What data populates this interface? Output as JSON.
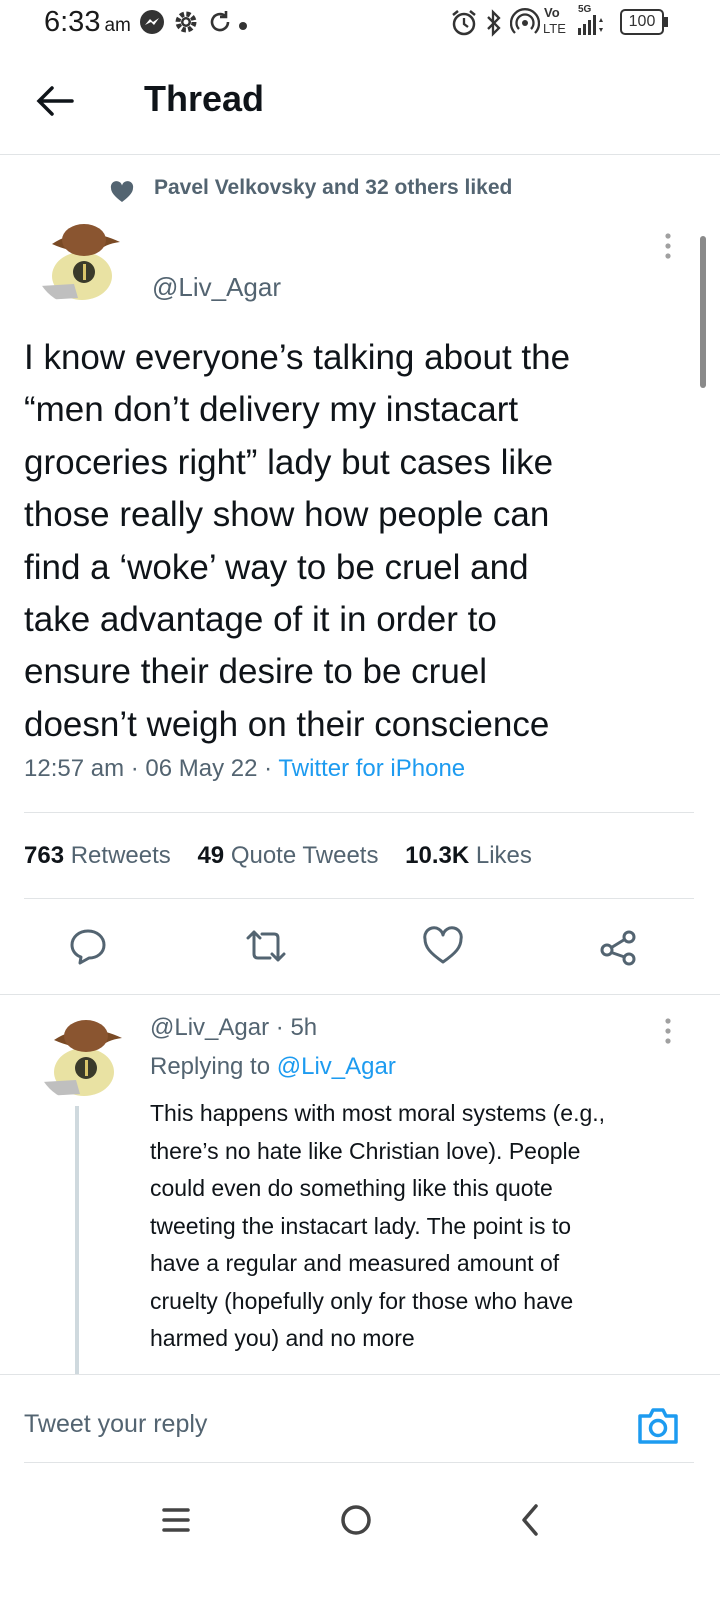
{
  "status_bar": {
    "time": "6:33",
    "ampm": "am",
    "network_vo": "Vo",
    "network_lte": "LTE",
    "network_5g": "5G",
    "battery": "100"
  },
  "header": {
    "title": "Thread"
  },
  "social_context": {
    "text": "Pavel Velkovsky and 32 others liked"
  },
  "main_tweet": {
    "handle": "@Liv_Agar",
    "text": "I know everyone’s talking about the\n“men don’t delivery my instacart\ngroceries right” lady but cases like\nthose really show how people can\nfind a ‘woke’ way to be cruel and\ntake advantage of it in order to\nensure their desire to be cruel\ndoesn’t weigh on their conscience",
    "time": "12:57 am",
    "date": "06 May 22",
    "source": "Twitter for iPhone",
    "separator": "·",
    "stats": {
      "retweets_count": "763",
      "retweets_label": "Retweets",
      "quotes_count": "49",
      "quotes_label": "Quote Tweets",
      "likes_count": "10.3K",
      "likes_label": "Likes"
    }
  },
  "reply_tweet": {
    "handle": "@Liv_Agar",
    "age": "5h",
    "separator": "·",
    "replying_to_label": "Replying to",
    "replying_to_handle": "@Liv_Agar",
    "text": "This happens with most moral systems (e.g.,\nthere’s no hate like Christian love). People\ncould even do something like this quote\ntweeting the instacart lady. The point is to\nhave a regular and measured amount of\ncruelty (hopefully only for those who have\nharmed you) and no more"
  },
  "reply_bar": {
    "placeholder": "Tweet your reply"
  },
  "colors": {
    "accent": "#1d9bf0",
    "text_primary": "#0f1419",
    "text_secondary": "#536471",
    "divider": "#e1e4e6"
  },
  "icons": [
    "messenger-icon",
    "settings-icon",
    "sync-icon",
    "alarm-icon",
    "bluetooth-icon",
    "hotspot-icon",
    "signal-icon",
    "battery-icon",
    "back-arrow-icon",
    "heart-icon",
    "more-icon",
    "reply-icon",
    "retweet-icon",
    "like-icon",
    "share-icon",
    "camera-icon",
    "recent-apps-icon",
    "home-icon",
    "back-icon"
  ]
}
